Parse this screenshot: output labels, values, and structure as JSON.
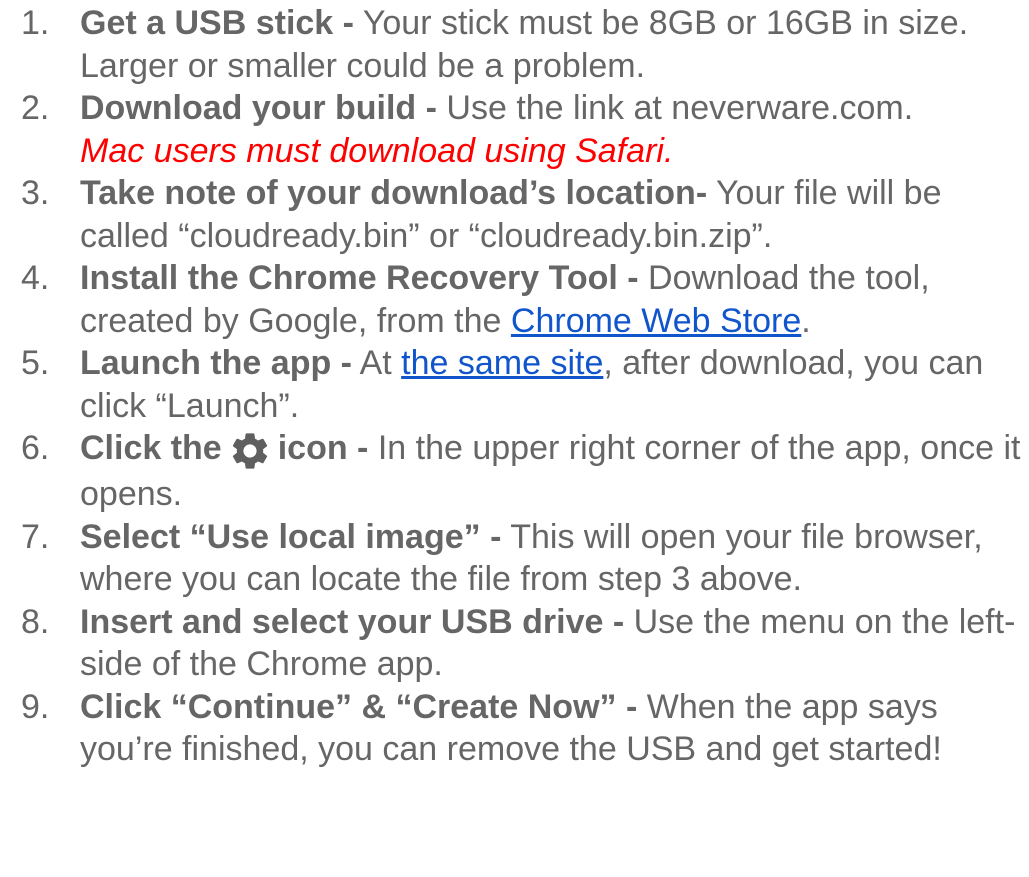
{
  "steps": [
    {
      "number": "1.",
      "lead": "Get a USB stick -",
      "text": " Your stick must be 8GB or 16GB in size. Larger or smaller could be a problem."
    },
    {
      "number": "2.",
      "lead": "Download your build -",
      "text": " Use the link at neverware.com.",
      "note": "Mac users must download using Safari."
    },
    {
      "number": "3.",
      "lead": "Take note of your download’s location-",
      "text": " Your file will be called “cloudready.bin” or “cloudready.bin.zip”."
    },
    {
      "number": "4.",
      "lead": "Install the Chrome Recovery Tool -",
      "text_before": " Download the tool, created by Google, from the ",
      "link": "Chrome Web Store",
      "text_after": "."
    },
    {
      "number": "5.",
      "lead": "Launch the app -",
      "text_before": " At ",
      "link": "the same site",
      "text_after": ", after download, you can click “Launch”."
    },
    {
      "number": "6.",
      "lead_before": "Click the",
      "icon": "gear-icon",
      "lead_after": "icon -",
      "text": " In the upper right corner of the app, once it opens."
    },
    {
      "number": "7.",
      "lead": "Select “Use local image” -",
      "text": " This will open your file browser, where you can locate the file from step 3 above."
    },
    {
      "number": "8.",
      "lead": "Insert and select your USB drive -",
      "text": " Use the menu on the left-side of the Chrome app."
    },
    {
      "number": "9.",
      "lead": "Click “Continue” & “Create Now” -",
      "text": " When the app says you’re finished, you can remove the USB and get started!"
    }
  ],
  "colors": {
    "body_text": "#666666",
    "note": "#ff0000",
    "link": "#1155cc",
    "icon": "#5f5f5f"
  }
}
